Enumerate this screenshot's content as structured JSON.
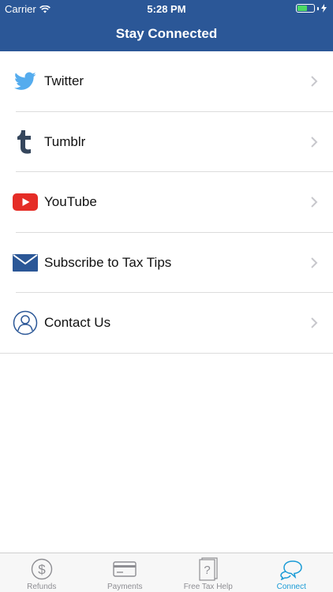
{
  "status_bar": {
    "carrier": "Carrier",
    "time": "5:28 PM",
    "battery_level": 0.6
  },
  "nav": {
    "title": "Stay Connected"
  },
  "list": {
    "items": [
      {
        "label": "Twitter",
        "icon": "twitter-icon"
      },
      {
        "label": "Tumblr",
        "icon": "tumblr-icon"
      },
      {
        "label": "YouTube",
        "icon": "youtube-icon"
      },
      {
        "label": "Subscribe to Tax Tips",
        "icon": "envelope-icon"
      },
      {
        "label": "Contact Us",
        "icon": "person-icon"
      }
    ]
  },
  "tabs": [
    {
      "label": "Refunds",
      "icon": "dollar-icon",
      "active": false
    },
    {
      "label": "Payments",
      "icon": "credit-card-icon",
      "active": false
    },
    {
      "label": "Free Tax Help",
      "icon": "question-document-icon",
      "active": false
    },
    {
      "label": "Connect",
      "icon": "speech-bubbles-icon",
      "active": true
    }
  ],
  "colors": {
    "header": "#2b5797",
    "twitter": "#55acee",
    "tumblr": "#35465c",
    "youtube": "#e52d27",
    "envelope": "#2b5797",
    "active_tab": "#1a9bd6",
    "inactive_tab": "#8e8e93"
  }
}
